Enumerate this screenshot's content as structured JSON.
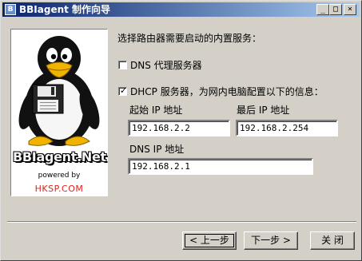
{
  "window": {
    "title": "BBIagent 制作向导",
    "controls": {
      "minimize": "_",
      "maximize": "□",
      "close": "×"
    }
  },
  "sidebar": {
    "brand": "BBIagent.Net",
    "powered_by": "powered by",
    "site": "HKSP.COM"
  },
  "main": {
    "prompt": "选择路由器需要启动的内置服务：",
    "dns_proxy": {
      "label": "DNS 代理服务器",
      "checked": false
    },
    "dhcp": {
      "label": "DHCP 服务器，为网内电脑配置以下的信息：",
      "checked": true
    },
    "start_ip": {
      "label": "起始 IP 地址",
      "value": "192.168.2.2"
    },
    "end_ip": {
      "label": "最后 IP 地址",
      "value": "192.168.2.254"
    },
    "dns_ip": {
      "label": "DNS IP 地址",
      "value": "192.168.2.1"
    }
  },
  "buttons": {
    "back": "< 上一步",
    "next": "下一步 >",
    "close": "关 闭"
  },
  "icons": [
    "penguin-icon",
    "floppy-disk-icon",
    "app-icon"
  ]
}
